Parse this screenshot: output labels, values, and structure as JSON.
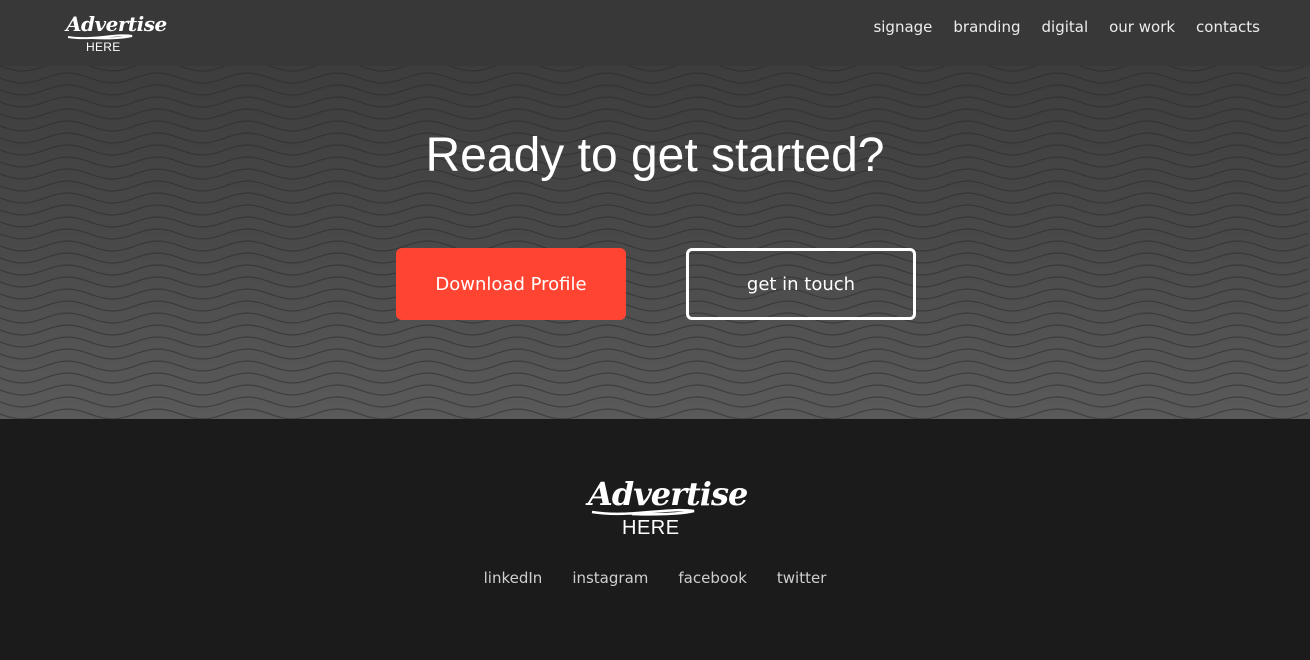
{
  "brand": {
    "logo_script": "Advertise",
    "logo_sub": "HERE"
  },
  "nav": {
    "items": [
      {
        "label": "signage"
      },
      {
        "label": "branding"
      },
      {
        "label": "digital"
      },
      {
        "label": "our work"
      },
      {
        "label": "contacts"
      }
    ]
  },
  "hero": {
    "title": "Ready to get started?",
    "primary_button": "Download Profile",
    "secondary_button": "get in touch"
  },
  "footer": {
    "logo_script": "Advertise",
    "logo_sub": "HERE",
    "social": [
      {
        "label": "linkedIn"
      },
      {
        "label": "instagram"
      },
      {
        "label": "facebook"
      },
      {
        "label": "twitter"
      }
    ]
  },
  "colors": {
    "header_bg": "#383838",
    "footer_bg": "#1b1b1b",
    "primary_button": "#ff4532",
    "text": "#ffffff"
  }
}
